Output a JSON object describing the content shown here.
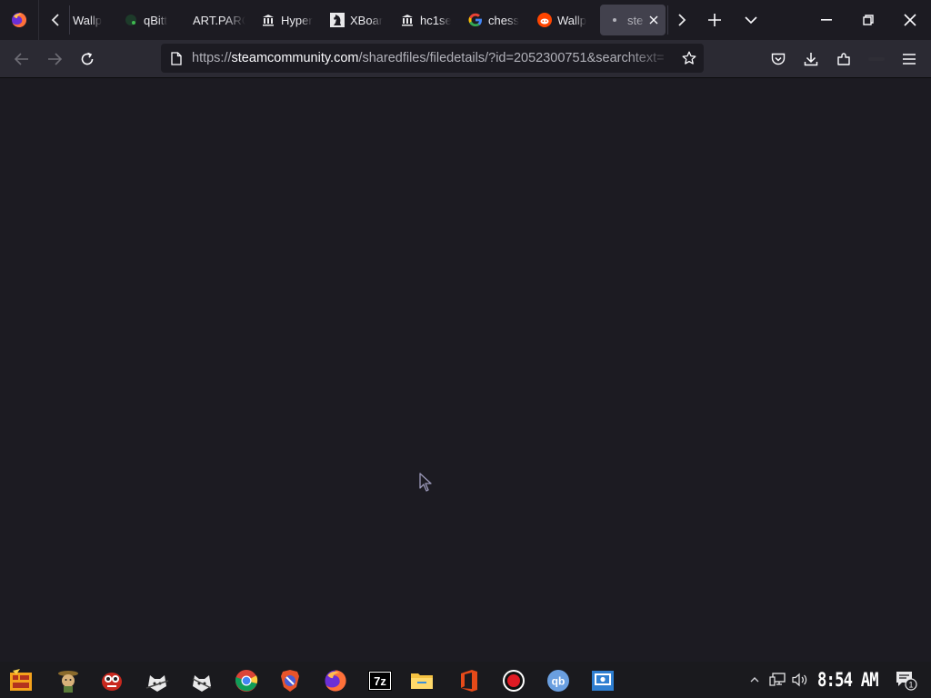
{
  "tabs": [
    {
      "label": "Wallp",
      "icon": "none"
    },
    {
      "label": "qBitt",
      "icon": "qbittorrent-icon"
    },
    {
      "label": "ART.PARC",
      "icon": "none"
    },
    {
      "label": "Hyper",
      "icon": "museum-icon"
    },
    {
      "label": "XBoar",
      "icon": "chess-knight-icon"
    },
    {
      "label": "hc1se",
      "icon": "museum-icon"
    },
    {
      "label": "chess",
      "icon": "google-icon"
    },
    {
      "label": "Wallp",
      "icon": "reddit-icon"
    },
    {
      "label": "ste",
      "icon": "loading-dot-icon",
      "active": true
    }
  ],
  "url": {
    "scheme": "https://",
    "host": "steamcommunity.com",
    "path": "/sharedfiles/filedetails/?id=2052300751&searchtext="
  },
  "clock": "8:54 AM",
  "notification_count": "1",
  "colors": {
    "background": "#1c1b22",
    "navbar": "#2b2a33",
    "urlbar": "#1c1b22",
    "active_tab": "#42414d",
    "taskbar": "#1a1a1e"
  }
}
